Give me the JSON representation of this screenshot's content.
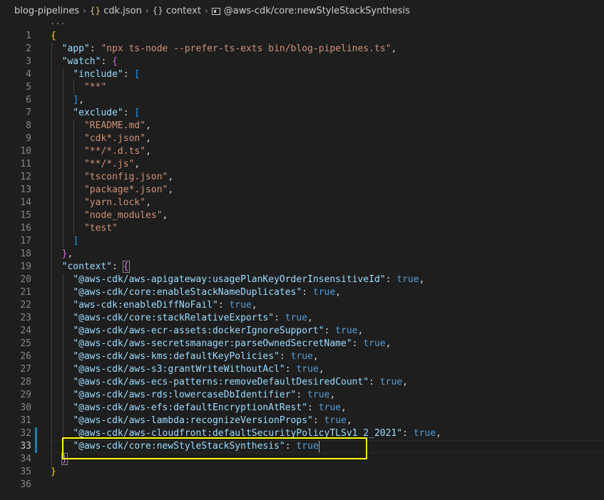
{
  "breadcrumb": [
    {
      "label": "blog-pipelines",
      "icon": ""
    },
    {
      "label": "cdk.json",
      "icon": "braces-icon"
    },
    {
      "label": "context",
      "icon": "braces-icon"
    },
    {
      "label": "@aws-cdk/core:newStyleStackSynthesis",
      "icon": "symbol-key-icon"
    }
  ],
  "breadcrumb_icon_text": "{}",
  "fold_marker": "...",
  "lines": [
    {
      "n": "1"
    },
    {
      "n": "2"
    },
    {
      "n": "3"
    },
    {
      "n": "4"
    },
    {
      "n": "5"
    },
    {
      "n": "6"
    },
    {
      "n": "7"
    },
    {
      "n": "8"
    },
    {
      "n": "9"
    },
    {
      "n": "10"
    },
    {
      "n": "11"
    },
    {
      "n": "12"
    },
    {
      "n": "13"
    },
    {
      "n": "14"
    },
    {
      "n": "15"
    },
    {
      "n": "16"
    },
    {
      "n": "17"
    },
    {
      "n": "18"
    },
    {
      "n": "19"
    },
    {
      "n": "20"
    },
    {
      "n": "21"
    },
    {
      "n": "22"
    },
    {
      "n": "23"
    },
    {
      "n": "24"
    },
    {
      "n": "25"
    },
    {
      "n": "26"
    },
    {
      "n": "27"
    },
    {
      "n": "28"
    },
    {
      "n": "29"
    },
    {
      "n": "30"
    },
    {
      "n": "31"
    },
    {
      "n": "32"
    },
    {
      "n": "33"
    },
    {
      "n": "34"
    },
    {
      "n": "35"
    },
    {
      "n": "36"
    }
  ],
  "code": {
    "app_key": "\"app\"",
    "app_val": "\"npx ts-node --prefer-ts-exts bin/blog-pipelines.ts\"",
    "watch_key": "\"watch\"",
    "include_key": "\"include\"",
    "include_items": [
      "\"**\""
    ],
    "exclude_key": "\"exclude\"",
    "exclude_items": [
      "\"README.md\"",
      "\"cdk*.json\"",
      "\"**/*.d.ts\"",
      "\"**/*.js\"",
      "\"tsconfig.json\"",
      "\"package*.json\"",
      "\"yarn.lock\"",
      "\"node_modules\"",
      "\"test\""
    ],
    "context_key": "\"context\"",
    "context_items": [
      "\"@aws-cdk/aws-apigateway:usagePlanKeyOrderInsensitiveId\"",
      "\"@aws-cdk/core:enableStackNameDuplicates\"",
      "\"aws-cdk:enableDiffNoFail\"",
      "\"@aws-cdk/core:stackRelativeExports\"",
      "\"@aws-cdk/aws-ecr-assets:dockerIgnoreSupport\"",
      "\"@aws-cdk/aws-secretsmanager:parseOwnedSecretName\"",
      "\"@aws-cdk/aws-kms:defaultKeyPolicies\"",
      "\"@aws-cdk/aws-s3:grantWriteWithoutAcl\"",
      "\"@aws-cdk/aws-ecs-patterns:removeDefaultDesiredCount\"",
      "\"@aws-cdk/aws-rds:lowercaseDbIdentifier\"",
      "\"@aws-cdk/aws-efs:defaultEncryptionAtRest\"",
      "\"@aws-cdk/aws-lambda:recognizeVersionProps\"",
      "\"@aws-cdk/aws-cloudfront:defaultSecurityPolicyTLSv1_2_2021\"",
      "\"@aws-cdk/core:newStyleStackSynthesis\""
    ],
    "true_literal": "true"
  },
  "current_line": "33",
  "colors": {
    "key": "#9cdcfe",
    "string": "#ce9178",
    "literal": "#569cd6",
    "highlight": "#ffff00"
  }
}
